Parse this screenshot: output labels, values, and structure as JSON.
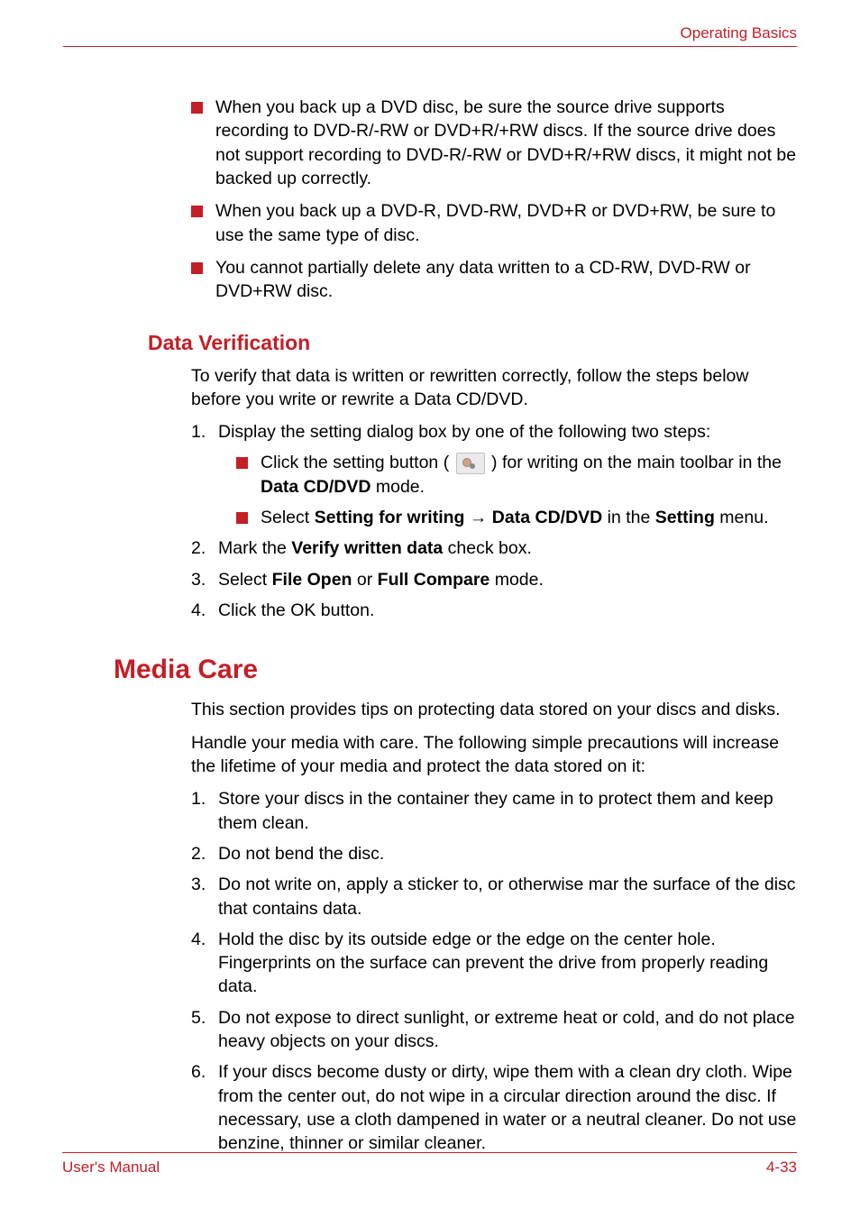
{
  "header": {
    "section_name": "Operating Basics"
  },
  "top_bullets": [
    "When you back up a DVD disc, be sure the source drive supports recording to DVD-R/-RW or DVD+R/+RW discs. If the source drive does not support recording to DVD-R/-RW or DVD+R/+RW discs, it might not be backed up correctly.",
    "When you back up a DVD-R, DVD-RW, DVD+R or DVD+RW, be sure to use the same type of disc.",
    "You cannot partially delete any data written to a CD-RW, DVD-RW or DVD+RW disc."
  ],
  "h2_data_verification": "Data Verification",
  "data_verification_intro": "To verify that data is written or rewritten correctly, follow the steps below before you write or rewrite a Data CD/DVD.",
  "dv_steps": {
    "s1": "Display the setting dialog box by one of the following two steps:",
    "s1a_pre": "Click the setting button (",
    "s1a_post": ") for writing on the main toolbar in the ",
    "s1a_bold": "Data CD/DVD",
    "s1a_end": " mode.",
    "s1b_pre": "Select ",
    "s1b_b1": "Setting for writing",
    "s1b_b2": "Data CD/DVD",
    "s1b_mid": " in the ",
    "s1b_b3": "Setting",
    "s1b_end": " menu.",
    "s2_pre": "Mark the ",
    "s2_b": "Verify written data",
    "s2_post": " check box.",
    "s3_pre": "Select ",
    "s3_b1": "File Open",
    "s3_mid": " or ",
    "s3_b2": "Full Compare",
    "s3_end": " mode.",
    "s4": "Click the OK button."
  },
  "h1_media_care": "Media Care",
  "media_care_p1": "This section provides tips on protecting data stored on your discs and disks.",
  "media_care_p2": "Handle your media with care. The following simple precautions will increase the lifetime of your media and protect the data stored on it:",
  "mc_steps": [
    "Store your discs in the container they came in to protect them and keep them clean.",
    "Do not bend the disc.",
    "Do not write on, apply a sticker to, or otherwise mar the surface of the disc that contains data.",
    "Hold the disc by its outside edge or the edge on the center hole. Fingerprints on the surface can prevent the drive from properly reading data.",
    "Do not expose to direct sunlight, or extreme heat or cold, and do not place heavy objects on your discs.",
    "If your discs become dusty or dirty, wipe them with a clean dry cloth. Wipe from the center out, do not wipe in a circular direction around the disc. If necessary, use a cloth dampened in water or a neutral cleaner. Do not use benzine, thinner or similar cleaner."
  ],
  "footer": {
    "left": "User's Manual",
    "right": "4-33"
  },
  "numbers": {
    "n1": "1.",
    "n2": "2.",
    "n3": "3.",
    "n4": "4.",
    "n5": "5.",
    "n6": "6."
  },
  "arrow": "→"
}
